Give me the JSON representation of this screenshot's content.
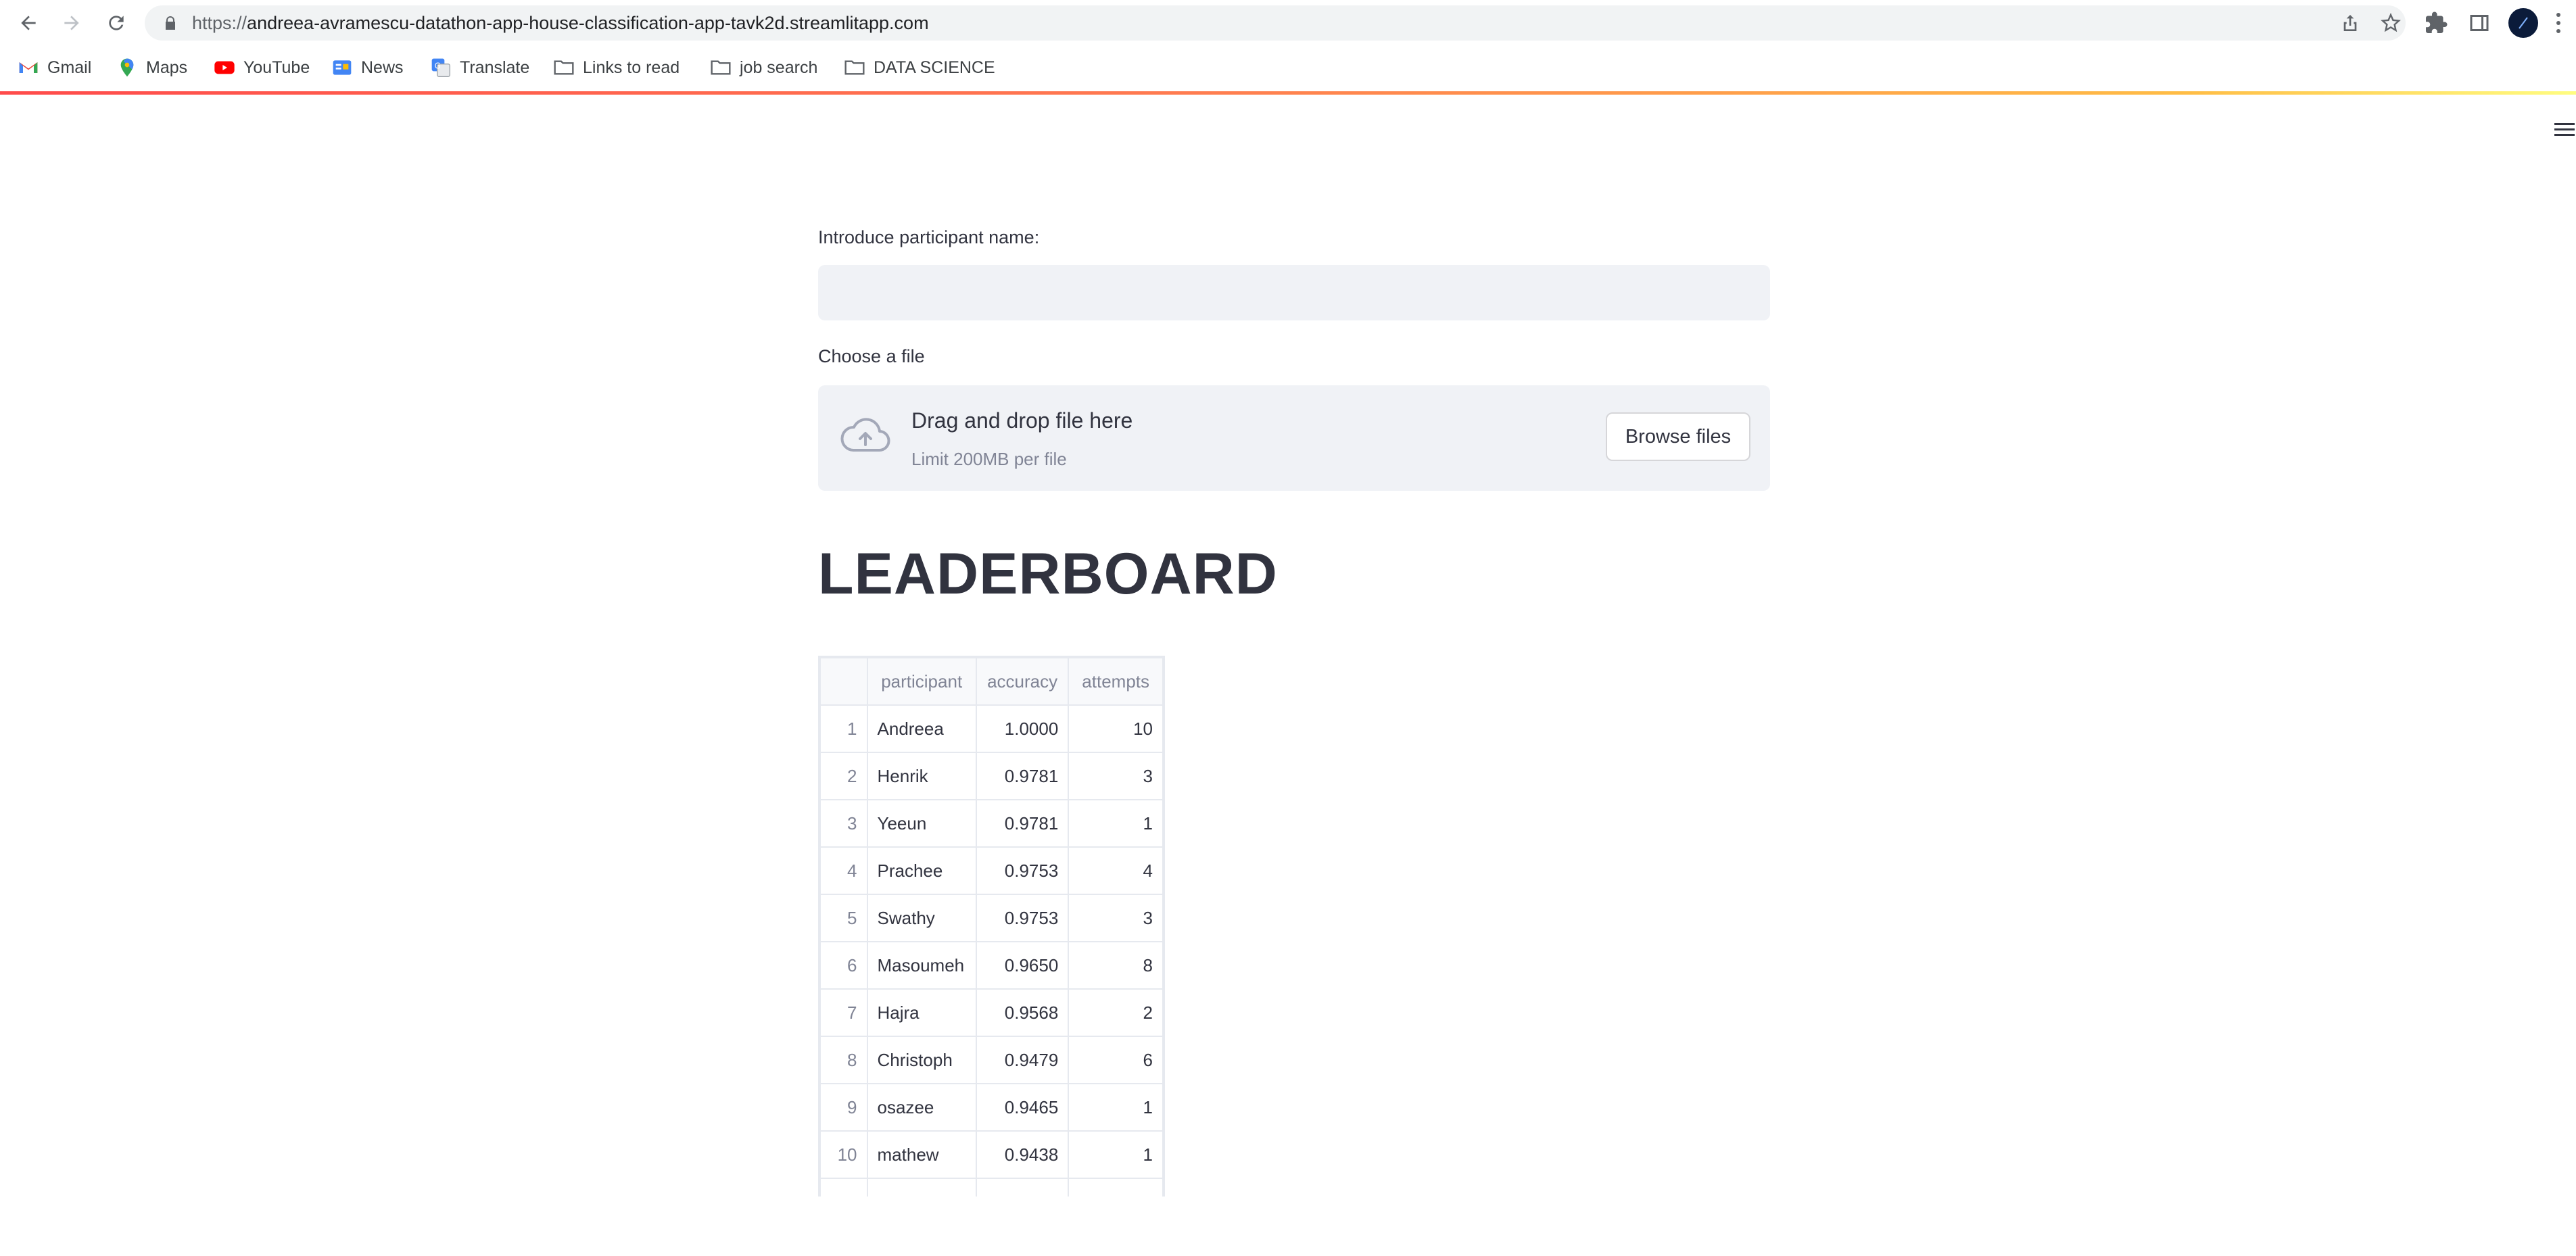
{
  "browser": {
    "url_scheme": "https://",
    "url_host": "andreea-avramescu-datathon-app-house-classification-app-tavk2d.streamlitapp.com",
    "bookmarks": [
      {
        "label": "Gmail",
        "icon": "gmail-icon"
      },
      {
        "label": "Maps",
        "icon": "maps-icon"
      },
      {
        "label": "YouTube",
        "icon": "youtube-icon"
      },
      {
        "label": "News",
        "icon": "news-icon"
      },
      {
        "label": "Translate",
        "icon": "translate-icon"
      },
      {
        "label": "Links to read",
        "icon": "folder-icon"
      },
      {
        "label": "job search",
        "icon": "folder-icon"
      },
      {
        "label": "DATA SCIENCE",
        "icon": "folder-icon"
      }
    ]
  },
  "form": {
    "name_label": "Introduce participant name:",
    "name_value": "",
    "file_label": "Choose a file",
    "dropzone_title": "Drag and drop file here",
    "dropzone_limit": "Limit 200MB per file",
    "browse_label": "Browse files"
  },
  "leaderboard": {
    "title": "LEADERBOARD",
    "columns": [
      "",
      "participant",
      "accuracy",
      "attempts"
    ],
    "rows": [
      {
        "index": "1",
        "participant": "Andreea",
        "accuracy": "1.0000",
        "attempts": "10"
      },
      {
        "index": "2",
        "participant": "Henrik",
        "accuracy": "0.9781",
        "attempts": "3"
      },
      {
        "index": "3",
        "participant": "Yeeun",
        "accuracy": "0.9781",
        "attempts": "1"
      },
      {
        "index": "4",
        "participant": "Prachee",
        "accuracy": "0.9753",
        "attempts": "4"
      },
      {
        "index": "5",
        "participant": "Swathy",
        "accuracy": "0.9753",
        "attempts": "3"
      },
      {
        "index": "6",
        "participant": "Masoumeh",
        "accuracy": "0.9650",
        "attempts": "8"
      },
      {
        "index": "7",
        "participant": "Hajra",
        "accuracy": "0.9568",
        "attempts": "2"
      },
      {
        "index": "8",
        "participant": "Christoph",
        "accuracy": "0.9479",
        "attempts": "6"
      },
      {
        "index": "9",
        "participant": "osazee",
        "accuracy": "0.9465",
        "attempts": "1"
      },
      {
        "index": "10",
        "participant": "mathew",
        "accuracy": "0.9438",
        "attempts": "1"
      }
    ]
  },
  "colors": {
    "accent": "#ff4b4b",
    "input_bg": "#f0f2f6",
    "text": "#31333f",
    "muted": "#808495"
  }
}
